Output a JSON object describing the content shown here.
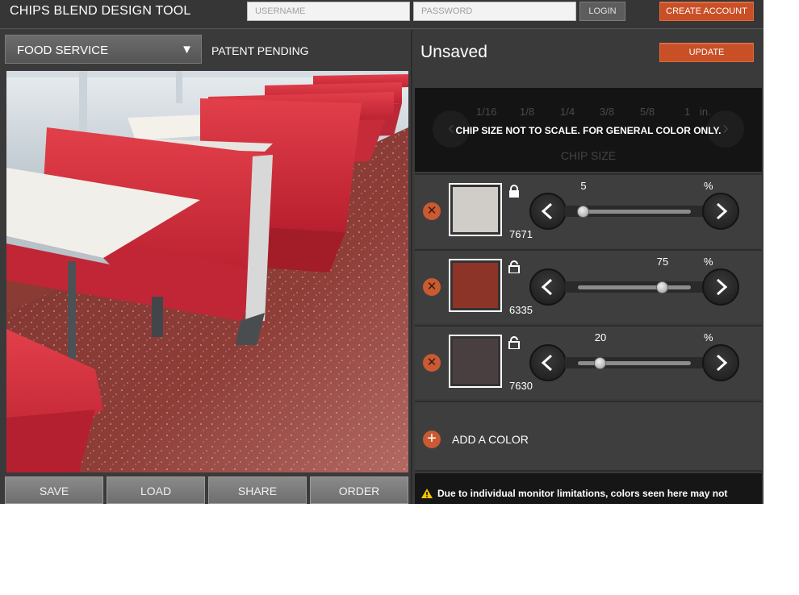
{
  "header": {
    "title": "CHIPS BLEND DESIGN TOOL",
    "username_placeholder": "USERNAME",
    "password_placeholder": "PASSWORD",
    "login_label": "LOGIN",
    "create_account_label": "CREATE ACCOUNT"
  },
  "left": {
    "dropdown": {
      "selected": "FOOD SERVICE"
    },
    "patent": "PATENT PENDING",
    "actions": {
      "save": "SAVE",
      "load": "LOAD",
      "share": "SHARE",
      "order": "ORDER"
    }
  },
  "right": {
    "blend_name": "Unsaved",
    "update_label": "UPDATE",
    "chip_size": {
      "sizes": [
        "1/16",
        "1/8",
        "1/4",
        "3/8",
        "5/8",
        "1"
      ],
      "unit": "in.",
      "notice": "CHIP SIZE NOT TO SCALE. FOR GENERAL COLOR ONLY.",
      "caption": "CHIP SIZE"
    },
    "colors": [
      {
        "code": "7671",
        "percent": "5",
        "fraction": 0.05,
        "swatch": "#d0ccc8",
        "locked": true
      },
      {
        "code": "6335",
        "percent": "75",
        "fraction": 0.75,
        "swatch": "#8b3427",
        "locked": false
      },
      {
        "code": "7630",
        "percent": "20",
        "fraction": 0.2,
        "swatch": "#4a3f40",
        "locked": false
      }
    ],
    "percent_sign": "%",
    "add_color_label": "ADD A COLOR",
    "warning": "Due to individual monitor limitations, colors seen here may not"
  }
}
